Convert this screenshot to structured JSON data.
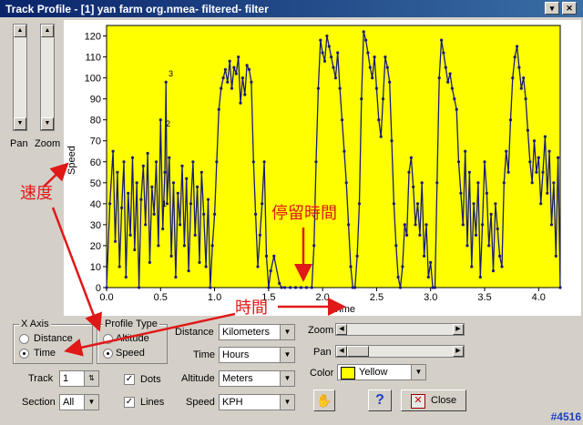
{
  "window": {
    "title": "Track Profile - [1] yan farm org.nmea- filtered- filter",
    "btn_restore": "▾",
    "btn_close": "✕"
  },
  "left": {
    "pan_label": "Pan",
    "zoom_label": "Zoom"
  },
  "annotations": {
    "speed_cn": "速度",
    "time_cn": "時間",
    "stop_cn": "停留時間"
  },
  "x_axis_group": {
    "title": "X Axis",
    "options": [
      "Distance",
      "Time"
    ],
    "selected": "Time"
  },
  "profile_group": {
    "title": "Profile Type",
    "options": [
      "Altitude",
      "Speed"
    ],
    "selected": "Speed"
  },
  "track": {
    "label": "Track",
    "value": "1"
  },
  "section": {
    "label": "Section",
    "value": "All"
  },
  "dots": {
    "label": "Dots",
    "checked": true
  },
  "lines": {
    "label": "Lines",
    "checked": true
  },
  "units": {
    "distance": {
      "label": "Distance",
      "value": "Kilometers"
    },
    "time": {
      "label": "Time",
      "value": "Hours"
    },
    "altitude": {
      "label": "Altitude",
      "value": "Meters"
    },
    "speed": {
      "label": "Speed",
      "value": "KPH"
    }
  },
  "zoom_label": "Zoom",
  "pan_label": "Pan",
  "color": {
    "label": "Color",
    "value": "Yellow",
    "swatch": "#ffff00"
  },
  "help_label": "?",
  "close_label": "Close",
  "watermark": "#4516",
  "chart_data": {
    "type": "line",
    "xlabel": "Time",
    "ylabel": "Speed",
    "xlim": [
      0,
      4.2
    ],
    "ylim": [
      0,
      125
    ],
    "xticks": [
      "0.0",
      "0.5",
      "1.0",
      "1.5",
      "2.0",
      "2.5",
      "3.0",
      "3.5",
      "4.0"
    ],
    "yticks": [
      "0",
      "10",
      "20",
      "30",
      "40",
      "50",
      "60",
      "70",
      "80",
      "90",
      "100",
      "110",
      "120"
    ],
    "bg_color": "#ffff00",
    "line_color": "#1a1a7a",
    "annotations": [
      "1",
      "2",
      "3"
    ],
    "series": [
      {
        "x": [
          0.0,
          0.03,
          0.06,
          0.08,
          0.1,
          0.12,
          0.14,
          0.16,
          0.18,
          0.2,
          0.22,
          0.24,
          0.26,
          0.28,
          0.3,
          0.32,
          0.34,
          0.36,
          0.38,
          0.4,
          0.42,
          0.44,
          0.46,
          0.48,
          0.5,
          0.52,
          0.54,
          0.55,
          0.56,
          0.58,
          0.6,
          0.62,
          0.64,
          0.66,
          0.68,
          0.7,
          0.72,
          0.74,
          0.76,
          0.78,
          0.8,
          0.82,
          0.84,
          0.86,
          0.88,
          0.9,
          0.92,
          0.94,
          0.96,
          0.98,
          1.0,
          1.02,
          1.04,
          1.06,
          1.08,
          1.1,
          1.12,
          1.14,
          1.16,
          1.18,
          1.2,
          1.22,
          1.24,
          1.26,
          1.28,
          1.3,
          1.32,
          1.34,
          1.36,
          1.38,
          1.4,
          1.42,
          1.44,
          1.46,
          1.48,
          1.5,
          1.52,
          1.55,
          1.6,
          1.62,
          1.65,
          1.7,
          1.75,
          1.8,
          1.85,
          1.9,
          1.92,
          1.94,
          1.96,
          1.98,
          2.0,
          2.02,
          2.04,
          2.06,
          2.08,
          2.1,
          2.12,
          2.14,
          2.16,
          2.18,
          2.2,
          2.22,
          2.24,
          2.26,
          2.28,
          2.3,
          2.32,
          2.34,
          2.36,
          2.38,
          2.4,
          2.42,
          2.44,
          2.46,
          2.48,
          2.5,
          2.52,
          2.54,
          2.56,
          2.58,
          2.6,
          2.62,
          2.64,
          2.66,
          2.68,
          2.7,
          2.72,
          2.74,
          2.76,
          2.78,
          2.8,
          2.82,
          2.84,
          2.86,
          2.88,
          2.9,
          2.92,
          2.94,
          2.96,
          2.98,
          3.0,
          3.02,
          3.04,
          3.06,
          3.08,
          3.1,
          3.12,
          3.14,
          3.16,
          3.18,
          3.2,
          3.22,
          3.24,
          3.26,
          3.28,
          3.3,
          3.32,
          3.34,
          3.36,
          3.38,
          3.4,
          3.42,
          3.44,
          3.46,
          3.48,
          3.5,
          3.52,
          3.54,
          3.56,
          3.58,
          3.6,
          3.62,
          3.64,
          3.66,
          3.68,
          3.7,
          3.72,
          3.74,
          3.76,
          3.78,
          3.8,
          3.82,
          3.84,
          3.86,
          3.88,
          3.9,
          3.92,
          3.94,
          3.96,
          3.98,
          4.0,
          4.02,
          4.04,
          4.06,
          4.08,
          4.1,
          4.12,
          4.14,
          4.16,
          4.18,
          4.2
        ],
        "y": [
          0,
          40,
          65,
          22,
          55,
          10,
          38,
          60,
          5,
          45,
          25,
          62,
          18,
          50,
          0,
          42,
          58,
          30,
          64,
          12,
          48,
          35,
          60,
          20,
          80,
          28,
          55,
          98,
          40,
          62,
          15,
          50,
          5,
          45,
          30,
          58,
          20,
          52,
          8,
          40,
          60,
          25,
          48,
          12,
          55,
          35,
          10,
          42,
          0,
          20,
          35,
          60,
          85,
          95,
          100,
          104,
          98,
          108,
          95,
          105,
          102,
          110,
          88,
          100,
          92,
          106,
          104,
          98,
          60,
          35,
          10,
          25,
          40,
          60,
          15,
          0,
          8,
          15,
          2,
          0,
          0,
          0,
          0,
          0,
          0,
          0,
          20,
          60,
          95,
          118,
          112,
          108,
          120,
          115,
          110,
          105,
          100,
          112,
          95,
          80,
          65,
          50,
          30,
          10,
          0,
          0,
          15,
          40,
          90,
          122,
          118,
          112,
          105,
          100,
          110,
          95,
          80,
          72,
          90,
          110,
          105,
          98,
          70,
          40,
          20,
          5,
          0,
          10,
          30,
          25,
          55,
          62,
          48,
          30,
          40,
          25,
          50,
          15,
          30,
          5,
          12,
          0,
          0,
          50,
          100,
          118,
          112,
          105,
          98,
          102,
          95,
          90,
          85,
          60,
          45,
          30,
          65,
          20,
          55,
          10,
          40,
          25,
          50,
          5,
          30,
          60,
          45,
          20,
          35,
          8,
          40,
          28,
          15,
          10,
          50,
          65,
          55,
          80,
          100,
          110,
          115,
          105,
          95,
          100,
          90,
          75,
          60,
          50,
          70,
          55,
          62,
          40,
          55,
          72,
          45,
          65,
          30,
          50,
          15,
          62,
          0
        ]
      }
    ]
  }
}
